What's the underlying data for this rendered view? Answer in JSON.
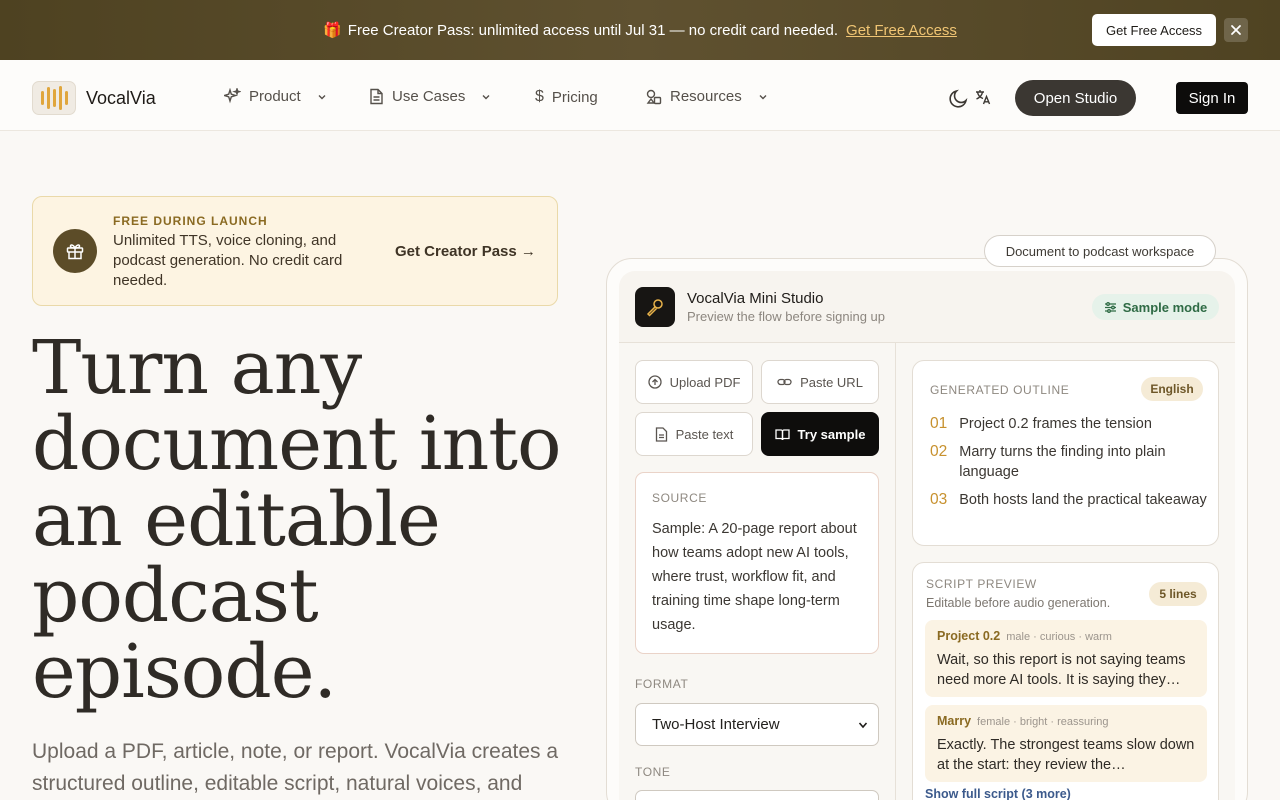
{
  "banner": {
    "message": "Free Creator Pass: unlimited access until Jul 31 — no credit card needed.",
    "link": "Get Free Access",
    "cta": "Get Free Access",
    "gift_icon": "gift-icon",
    "close_icon": "close-icon"
  },
  "nav": {
    "brand": "VocalVia",
    "items": [
      {
        "label": "Product",
        "icon": "sparkles-icon",
        "dropdown": true
      },
      {
        "label": "Use Cases",
        "icon": "document-icon",
        "dropdown": true
      },
      {
        "label": "Pricing",
        "icon": "dollar-icon",
        "dropdown": false
      },
      {
        "label": "Resources",
        "icon": "shapes-icon",
        "dropdown": true
      }
    ],
    "open_studio": "Open Studio",
    "sign_in": "Sign In"
  },
  "promo": {
    "eyebrow": "FREE DURING LAUNCH",
    "description": "Unlimited TTS, voice cloning, and podcast generation. No credit card needed.",
    "cta": "Get Creator Pass →"
  },
  "hero": {
    "headline": "Turn any document into an editable podcast episode.",
    "subheadline": "Upload a PDF, article, note, or report. VocalVia creates a structured outline, editable script, natural voices, and"
  },
  "studio": {
    "tag": "Document to podcast workspace",
    "title": "VocalVia Mini Studio",
    "subtitle": "Preview the flow before signing up",
    "mode": "Sample mode",
    "inputs": {
      "upload_pdf": "Upload PDF",
      "paste_url": "Paste URL",
      "paste_text": "Paste text",
      "try_sample": "Try sample"
    },
    "source": {
      "label": "SOURCE",
      "text": "Sample: A 20-page report about how teams adopt new AI tools, where trust, workflow fit, and training time shape long-term usage."
    },
    "format": {
      "label": "FORMAT",
      "value": "Two-Host Interview"
    },
    "tone": {
      "label": "TONE"
    },
    "outline": {
      "label": "GENERATED OUTLINE",
      "language": "English",
      "items": [
        {
          "num": "01",
          "text": "Project 0.2 frames the tension"
        },
        {
          "num": "02",
          "text": "Marry turns the finding into plain language"
        },
        {
          "num": "03",
          "text": "Both hosts land the practical takeaway"
        }
      ]
    },
    "script": {
      "label": "SCRIPT PREVIEW",
      "hint": "Editable before audio generation.",
      "count": "5 lines",
      "lines": [
        {
          "speaker": "Project 0.2",
          "meta": "male · curious · warm",
          "text": "Wait, so this report is not saying teams need more AI tools. It is saying they…"
        },
        {
          "speaker": "Marry",
          "meta": "female · bright · reassuring",
          "text": "Exactly. The strongest teams slow down at the start: they review the…"
        }
      ],
      "show_full": "Show full script (3 more)"
    }
  }
}
